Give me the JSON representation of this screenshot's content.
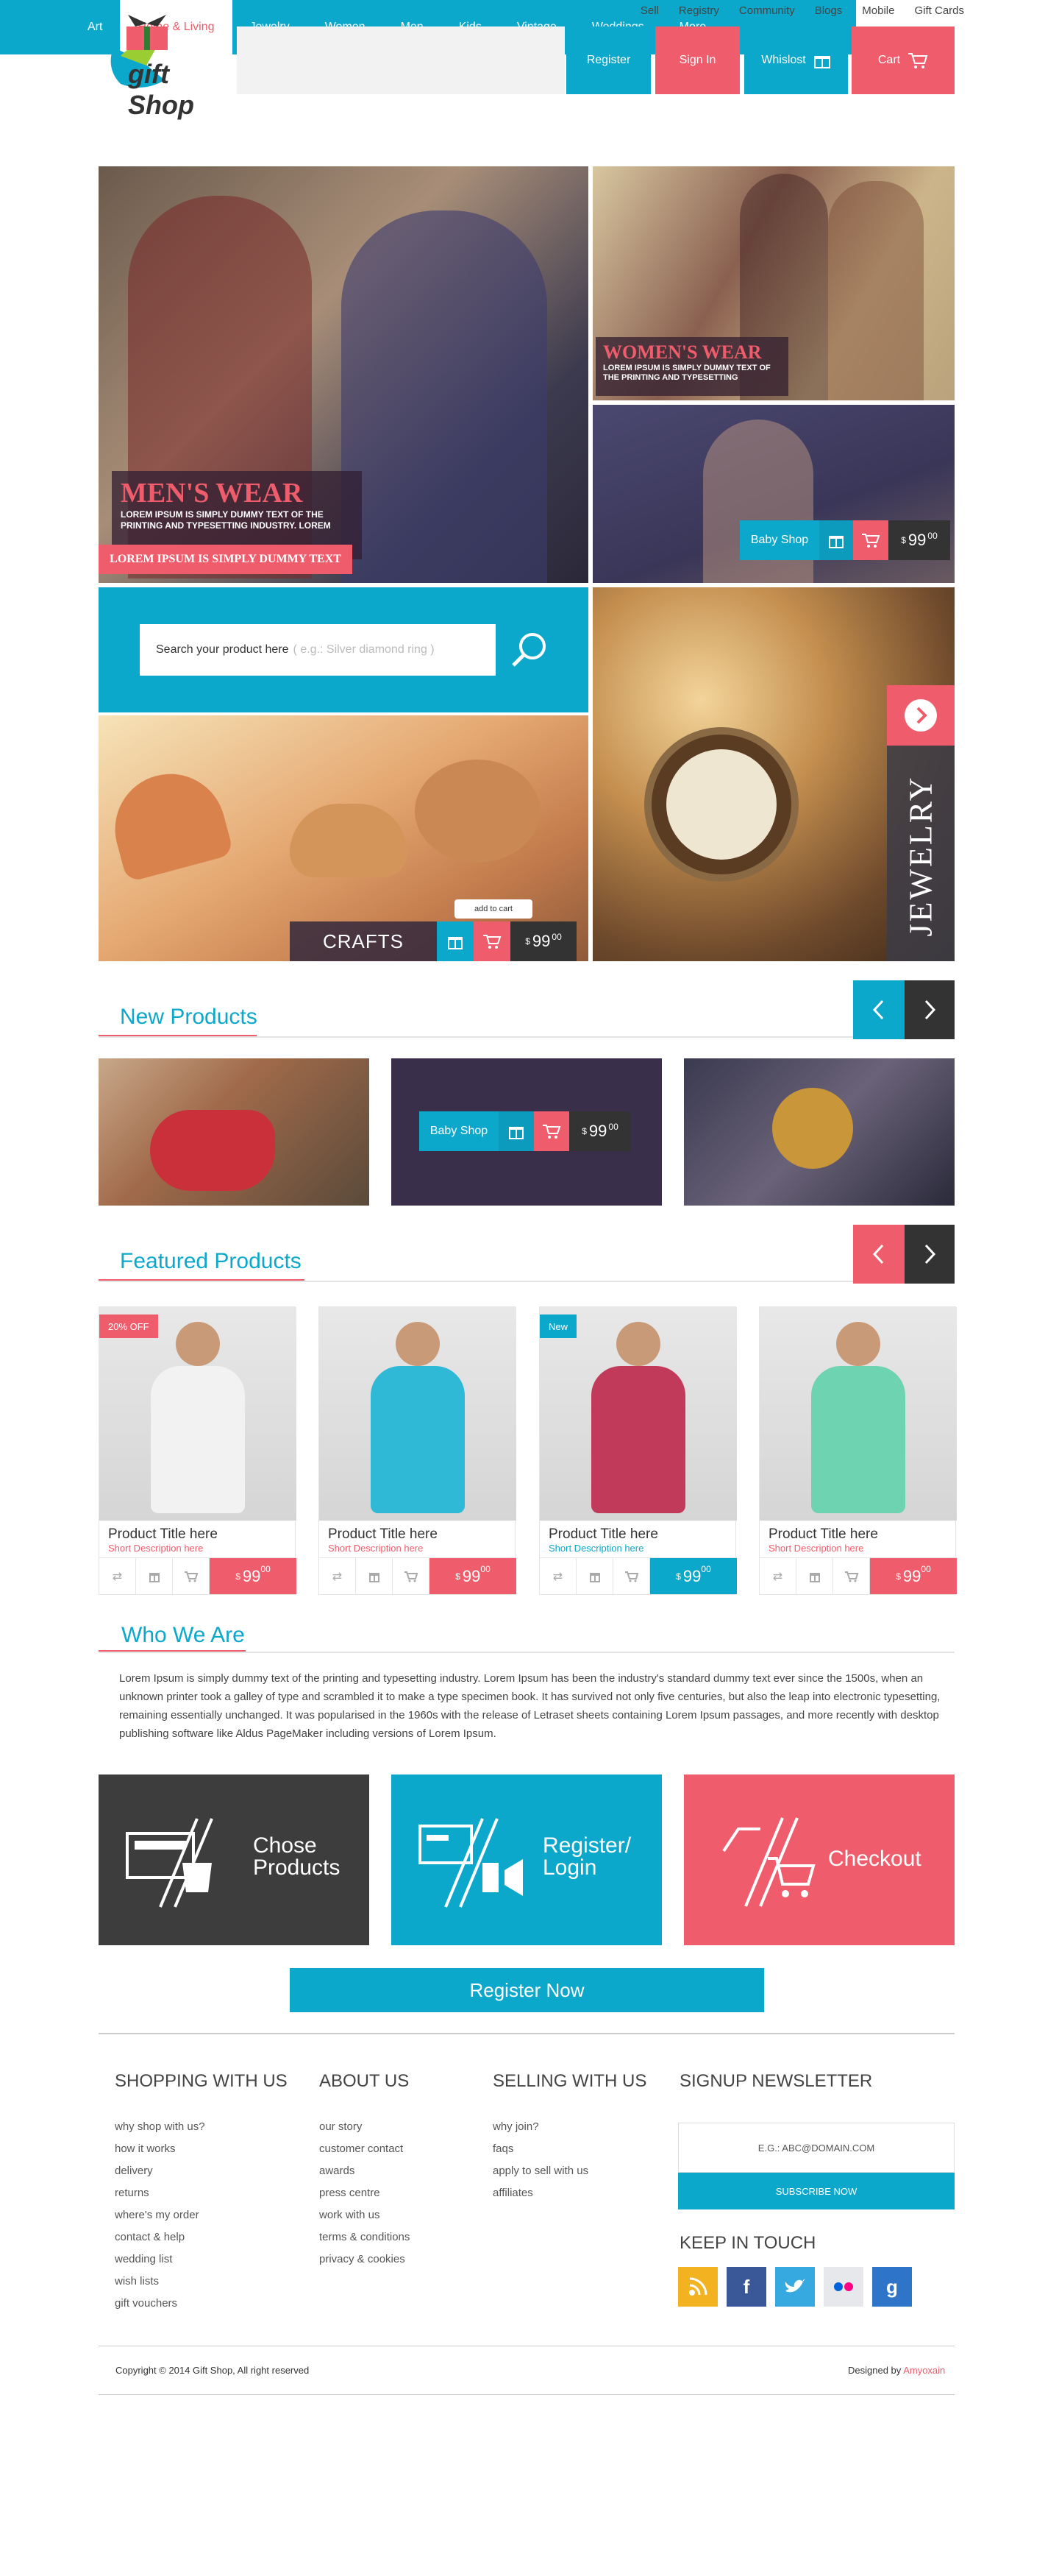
{
  "header": {
    "top_links": [
      "Sell",
      "Registry",
      "Community",
      "Blogs",
      "Mobile",
      "Gift Cards"
    ],
    "logo_text": "gift Shop",
    "register": "Register",
    "signin": "Sign In",
    "wishlist": "Whislost",
    "cart": "Cart"
  },
  "nav": {
    "items": [
      "Art",
      "Home & Living",
      "Jewelry",
      "Women",
      "Men",
      "Kids",
      "Vintage",
      "Weddings",
      "More"
    ],
    "active_index": 1
  },
  "hero": {
    "mens_title": "MEN'S WEAR",
    "mens_desc": "LOREM IPSUM IS SIMPLY DUMMY TEXT OF THE PRINTING AND TYPESETTING INDUSTRY. LOREM",
    "mens_banner": "LOREM IPSUM IS SIMPLY DUMMY TEXT",
    "womens_title": "WOMEN'S WEAR",
    "womens_desc": "LOREM IPSUM IS SIMPLY DUMMY TEXT OF THE PRINTING AND TYPESETTING",
    "baby_label": "Baby Shop",
    "baby_price_currency": "$",
    "baby_price": "99",
    "baby_price_cents": "00",
    "search_placeholder_bold": "Search your product here",
    "search_placeholder_hint": "( e.g.: Silver diamond ring )",
    "jewelry_label": "JEWELRY",
    "crafts_label": "CRAFTS",
    "crafts_tooltip": "add to cart",
    "crafts_price_currency": "$",
    "crafts_price": "99",
    "crafts_price_cents": "00"
  },
  "new_products": {
    "title": "New Products",
    "baby_label": "Baby Shop",
    "price_currency": "$",
    "price": "99",
    "price_cents": "00"
  },
  "featured": {
    "title": "Featured Products",
    "products": [
      {
        "title": "Product Title here",
        "desc": "Short Description here",
        "badge": "20% OFF",
        "currency": "$",
        "price": "99",
        "cents": "00",
        "accent": "#ef5d6c"
      },
      {
        "title": "Product Title here",
        "desc": "Short Description here",
        "badge": "",
        "currency": "$",
        "price": "99",
        "cents": "00",
        "accent": "#ef5d6c"
      },
      {
        "title": "Product Title here",
        "desc": "Short Description here",
        "badge": "New",
        "currency": "$",
        "price": "99",
        "cents": "00",
        "accent": "#0ca8cc"
      },
      {
        "title": "Product Title here",
        "desc": "Short Description here",
        "badge": "",
        "currency": "$",
        "price": "99",
        "cents": "00",
        "accent": "#ef5d6c"
      }
    ]
  },
  "who": {
    "title": "Who We Are",
    "text": "Lorem Ipsum is simply dummy text of the printing and typesetting industry. Lorem Ipsum has been the industry's standard dummy text ever since the 1500s, when an unknown printer took a galley of type and scrambled it to make a type specimen book. It has survived not only five centuries, but also the leap into electronic typesetting, remaining essentially unchanged. It was popularised in the 1960s with the release of Letraset sheets containing Lorem Ipsum passages, and more recently with desktop publishing software like Aldus PageMaker including versions of Lorem Ipsum."
  },
  "steps": {
    "chose": "Chose Products",
    "register": "Register/ Login",
    "checkout": "Checkout",
    "register_now": "Register Now"
  },
  "footer": {
    "col1_title": "SHOPPING WITH US",
    "col1_items": [
      "why shop with us?",
      "how it works",
      "delivery",
      "returns",
      "where's my order",
      "contact & help",
      "wedding list",
      "wish lists",
      "gift vouchers"
    ],
    "col2_title": "ABOUT US",
    "col2_items": [
      "our story",
      "customer contact",
      "awards",
      "press centre",
      "work with us",
      "terms & conditions",
      "privacy & cookies"
    ],
    "col3_title": "SELLING WITH US",
    "col3_items": [
      "why join?",
      "faqs",
      "apply to sell with us",
      "affiliates"
    ],
    "newsletter_title": "SIGNUP NEWSLETTER",
    "newsletter_placeholder": "E.G.: ABC@DOMAIN.COM",
    "subscribe": "SUBSCRIBE NOW",
    "keep_title": "KEEP IN TOUCH",
    "social_icons": [
      "rss-icon",
      "facebook-icon",
      "twitter-icon",
      "flickr-icon",
      "google-icon"
    ],
    "copyright": "Copyright © 2014 Gift Shop,  All right reserved",
    "designed_by": "Designed by",
    "designer": "Amyoxain"
  },
  "colors": {
    "blue": "#0ca8cc",
    "pink": "#ef5d6c",
    "dark": "#333333"
  }
}
